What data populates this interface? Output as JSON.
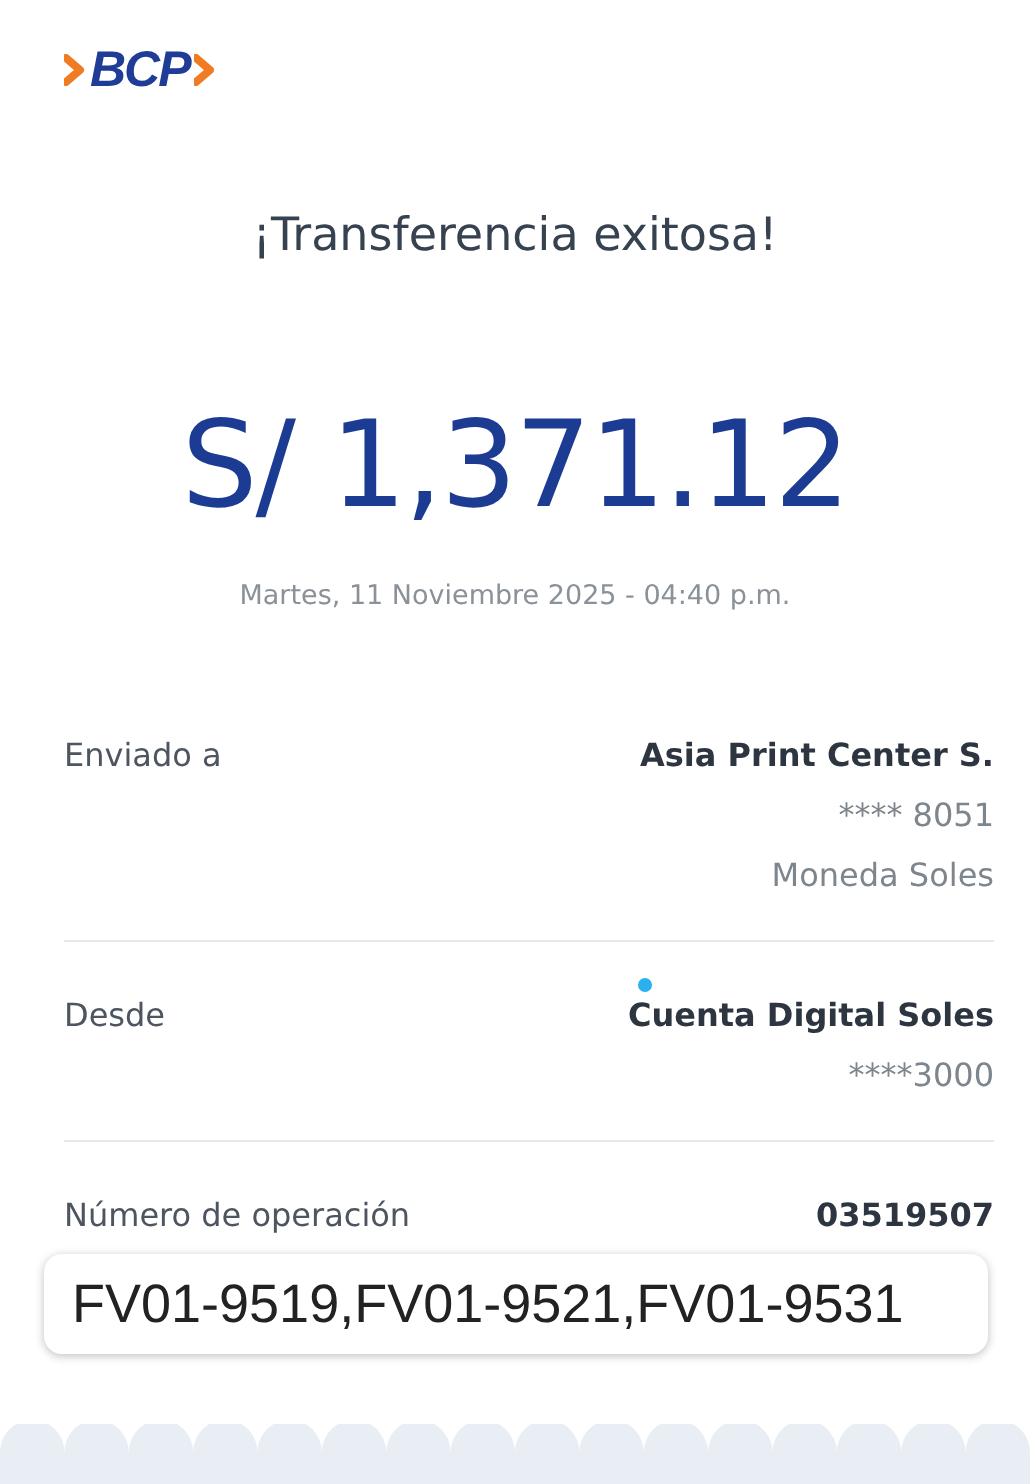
{
  "logo": {
    "text": "BCP"
  },
  "title": "¡Transferencia exitosa!",
  "amount": "S/ 1,371.12",
  "datetime": "Martes, 11 Noviembre 2025 - 04:40 p.m.",
  "details": [
    {
      "label": "Enviado a",
      "values": [
        "Asia Print Center S.",
        "**** 8051",
        "Moneda Soles"
      ]
    },
    {
      "label": "Desde",
      "values": [
        "Cuenta Digital Soles",
        "****3000"
      ]
    },
    {
      "label": "Número de operación",
      "values": [
        "03519507"
      ]
    }
  ],
  "note": "FV01-9519,FV01-9521,FV01-9531"
}
